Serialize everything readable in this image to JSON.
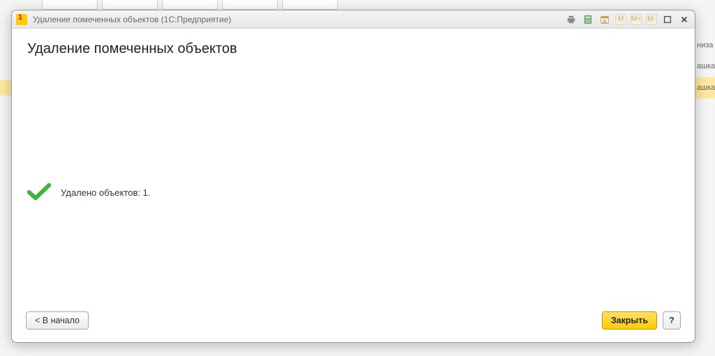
{
  "background": {
    "right_rows": [
      "низа",
      "ашка",
      "ашка"
    ]
  },
  "titlebar": {
    "title": "Удаление помеченных объектов (1С:Предприятие)",
    "m_buttons": [
      "M",
      "M+",
      "M-"
    ]
  },
  "content": {
    "heading": "Удаление помеченных объектов",
    "result_text": "Удалено объектов: 1."
  },
  "footer": {
    "back_label": "< В начало",
    "close_label": "Закрыть",
    "help_label": "?"
  }
}
